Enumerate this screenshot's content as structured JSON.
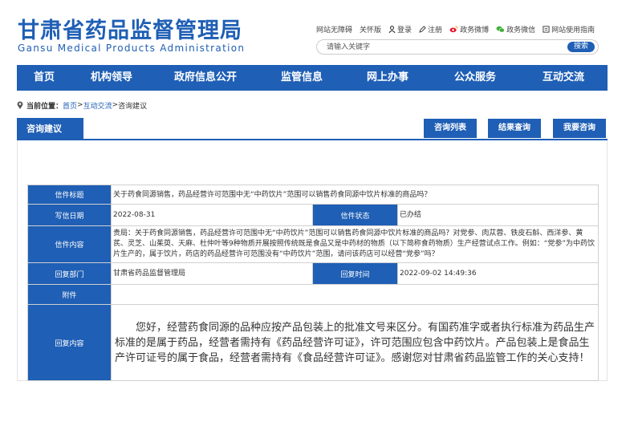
{
  "header": {
    "title_cn": "甘肃省药品监督管理局",
    "title_en": "Gansu Medical Products Administration",
    "links": [
      {
        "label": "网站无障碍",
        "icon": ""
      },
      {
        "label": "关怀版",
        "icon": ""
      },
      {
        "label": "登录",
        "icon": "user-icon"
      },
      {
        "label": "注册",
        "icon": "edit-icon"
      },
      {
        "label": "政务微博",
        "icon": "weibo-icon"
      },
      {
        "label": "政务微信",
        "icon": "wechat-icon"
      },
      {
        "label": "网站使用指南",
        "icon": "guide-icon"
      }
    ],
    "search_placeholder": "请输入关键字",
    "search_button": "搜索"
  },
  "nav": [
    "首页",
    "机构领导",
    "政府信息公开",
    "监管信息",
    "网上办事",
    "公众服务",
    "互动交流"
  ],
  "breadcrumb": {
    "label": "当前位置：",
    "items": [
      "首页",
      "互动交流",
      "咨询建议"
    ],
    "sep": ">"
  },
  "section": {
    "title": "咨询建议",
    "buttons": [
      "咨询列表",
      "结果查询",
      "我要咨询"
    ]
  },
  "letter": {
    "title_label": "信件标题",
    "title": "关于药食同源销售，药品经营许可范围中无“中药饮片”范围可以销售药食同源中饮片标准的商品吗？",
    "date_label": "写信日期",
    "date": "2022-08-31",
    "status_label": "信件状态",
    "status": "已办结",
    "content_label": "信件内容",
    "content": "贵局：关于药食同源销售，药品经营许可范围中无“中药饮片”范围可以销售药食同源中饮片标准的商品吗？对党参、肉苁蓉、铁皮石斛、西洋参、黄芪、灵芝、山茱萸、天麻、杜仲叶等9种物质开展按照传统既是食品又是中药材的物质（以下简称食药物质）生产经营试点工作。例如：“党参”为中药饮片生产的，属于饮片，药店的药品经营许可范围没有“中药饮片”范围，请问该药店可以经营“党参”吗？",
    "dept_label": "回复部门",
    "dept": "甘肃省药品监督管理局",
    "reply_time_label": "回复时间",
    "reply_time": "2022-09-02 14:49:36",
    "attach_label": "附件",
    "attach": "",
    "reply_label": "回复内容",
    "reply": "您好，经营药食同源的品种应按产品包装上的批准文号来区分。有国药准字或者执行标准为药品生产标准的是属于药品，经营者需持有《药品经营许可证》，许可范围应包含中药饮片。产品包装上是食品生产许可证号的属于食品，经营者需持有《食品经营许可证》。感谢您对甘肃省药品监管工作的关心支持！"
  },
  "colors": {
    "brand": "#1f5fb5",
    "label_bg": "#1f5fb5"
  }
}
